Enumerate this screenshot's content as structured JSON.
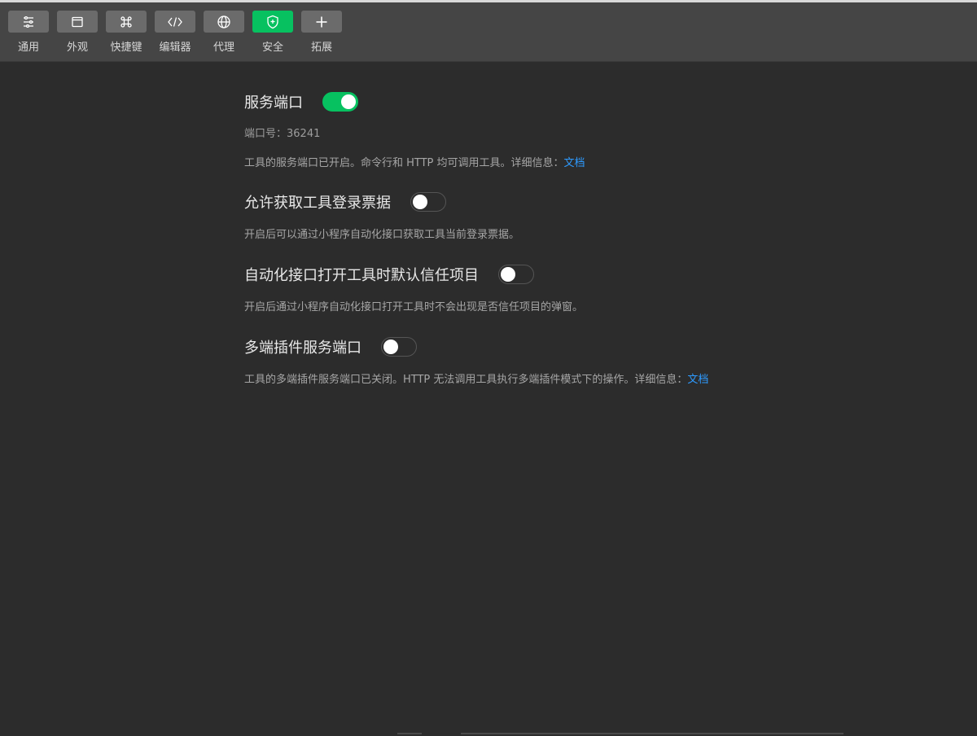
{
  "toolbar": {
    "tabs": [
      {
        "label": "通用",
        "icon": "sliders-icon"
      },
      {
        "label": "外观",
        "icon": "window-icon"
      },
      {
        "label": "快捷键",
        "icon": "command-key-icon"
      },
      {
        "label": "编辑器",
        "icon": "code-icon"
      },
      {
        "label": "代理",
        "icon": "globe-icon"
      },
      {
        "label": "安全",
        "icon": "shield-icon",
        "active": true
      },
      {
        "label": "拓展",
        "icon": "plus-icon"
      }
    ],
    "active_color": "#07c160"
  },
  "settings": {
    "service_port": {
      "title": "服务端口",
      "enabled": true,
      "port_label": "端口号：36241",
      "desc_text": "工具的服务端口已开启。命令行和 HTTP 均可调用工具。详细信息：",
      "link_text": "文档"
    },
    "login_ticket": {
      "title": "允许获取工具登录票据",
      "enabled": false,
      "desc_text": "开启后可以通过小程序自动化接口获取工具当前登录票据。"
    },
    "trust_project": {
      "title": "自动化接口打开工具时默认信任项目",
      "enabled": false,
      "desc_text": "开启后通过小程序自动化接口打开工具时不会出现是否信任项目的弹窗。"
    },
    "multi_plugin_port": {
      "title": "多端插件服务端口",
      "enabled": false,
      "desc_text": "工具的多端插件服务端口已关闭。HTTP 无法调用工具执行多端插件模式下的操作。详细信息：",
      "link_text": "文档"
    }
  },
  "colors": {
    "background": "#2c2c2c",
    "toolbar": "#454545",
    "link": "#2e9bff",
    "toggle_on": "#07c160"
  }
}
